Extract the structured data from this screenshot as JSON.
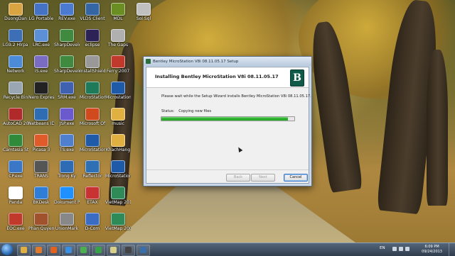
{
  "desktop_icons": [
    {
      "label": "DuongDan",
      "color": "#d9a441"
    },
    {
      "label": "LG9.2 Hlrpad",
      "color": "#3d6fb6"
    },
    {
      "label": "Network",
      "color": "#4c8bd8"
    },
    {
      "label": "Recycle Bin",
      "color": "#9aa7b3"
    },
    {
      "label": "AutoCAD 2007",
      "color": "#b02a2a"
    },
    {
      "label": "Camtasia Studio 7",
      "color": "#2f8a3a"
    },
    {
      "label": "CP.exe",
      "color": "#3a77c7"
    },
    {
      "label": "Panda",
      "color": "#ffffff"
    },
    {
      "label": "EOC.exe",
      "color": "#c0392b"
    },
    {
      "label": "LG Portable",
      "color": "#4472c4"
    },
    {
      "label": "LRC.exe",
      "color": "#5b8fd6"
    },
    {
      "label": "IS.exe",
      "color": "#7a6cc2"
    },
    {
      "label": "Nero Express",
      "color": "#222222"
    },
    {
      "label": "Netbeans IDE 7.3",
      "color": "#2f6db3"
    },
    {
      "label": "Picasa 3",
      "color": "#e05b2a"
    },
    {
      "label": "TRANS",
      "color": "#555555"
    },
    {
      "label": "BKDesk",
      "color": "#2e7dd7"
    },
    {
      "label": "Phan Quyen",
      "color": "#a0522d"
    },
    {
      "label": "REV.exe",
      "color": "#4b7bd0"
    },
    {
      "label": "SharpDevelop 4.1",
      "color": "#3f8a3f"
    },
    {
      "label": "SharpDevelop 4.1",
      "color": "#3f8a3f"
    },
    {
      "label": "SRM.exe",
      "color": "#4060b0"
    },
    {
      "label": "JSP.exe",
      "color": "#6a5acd"
    },
    {
      "label": "TS.exe",
      "color": "#4f7fcf"
    },
    {
      "label": "Trong Ky",
      "color": "#2d6bb5"
    },
    {
      "label": "Dokument Pro",
      "color": "#1e90ff"
    },
    {
      "label": "UnionMark",
      "color": "#888888"
    },
    {
      "label": "VLDS Client",
      "color": "#3465a4"
    },
    {
      "label": "eclipse",
      "color": "#2c2255"
    },
    {
      "label": "InstallShield 2009",
      "color": "#999999"
    },
    {
      "label": "MicroStation 2013",
      "color": "#1f7a5a"
    },
    {
      "label": "Microsoft Office",
      "color": "#d04a1e"
    },
    {
      "label": "MicroStation 8i",
      "color": "#1f5aa8"
    },
    {
      "label": "Reflector",
      "color": "#2f6fb3"
    },
    {
      "label": "ETAX",
      "color": "#c83232"
    },
    {
      "label": "D-Com",
      "color": "#3b6cc4"
    },
    {
      "label": "MDL",
      "color": "#6b8e23"
    },
    {
      "label": "The Gaps",
      "color": "#b0b0b0"
    },
    {
      "label": "Ferry 2007",
      "color": "#c0392b"
    },
    {
      "label": "Microstation 8i",
      "color": "#1f5aa8"
    },
    {
      "label": "music",
      "color": "#e0b040"
    },
    {
      "label": "KhachHang",
      "color": "#e0b040"
    },
    {
      "label": "MicroStation V8i XM",
      "color": "#1f5aa8"
    },
    {
      "label": "VietMap 2013",
      "color": "#2e8b57"
    },
    {
      "label": "VietMap 2008",
      "color": "#2e8b57"
    },
    {
      "label": "Sol Sql",
      "color": "#c0c0c0"
    }
  ],
  "installer": {
    "window_title": "Bentley MicroStation V8i 08.11.05.17 Setup",
    "header_title": "Installing Bentley MicroStation V8i 08.11.05.17",
    "logo_letter": "B",
    "message": "Please wait while the Setup Wizard installs Bentley MicroStation V8i 08.11.05.17.",
    "status_label": "Status:",
    "status_value": "Copying new files",
    "progress": 0.95,
    "buttons": {
      "back": "Back",
      "next": "Next",
      "cancel": "Cancel"
    }
  },
  "taskbar": {
    "apps": [
      {
        "name": "folder-icon",
        "color": "#e0b040"
      },
      {
        "name": "media-player-icon",
        "color": "#e07a2a"
      },
      {
        "name": "firefox-icon",
        "color": "#e2621f"
      },
      {
        "name": "ie-icon",
        "color": "#3b8fe0"
      },
      {
        "name": "chrome-icon",
        "color": "#4caf50"
      },
      {
        "name": "refresh-icon",
        "color": "#3aa04a"
      },
      {
        "name": "notepad-icon",
        "color": "#d8d08a"
      },
      {
        "name": "film-icon",
        "color": "#444444"
      },
      {
        "name": "installer-icon",
        "color": "#3a6ea8"
      }
    ],
    "language": "EN",
    "time": "6:09 PM",
    "date": "09/24/2013"
  }
}
